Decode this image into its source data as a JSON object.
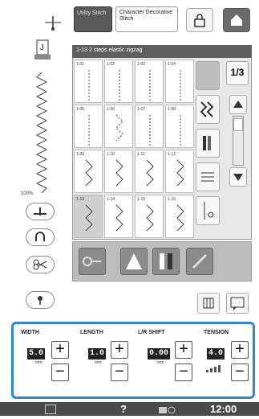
{
  "tabs": {
    "utility_label": "Utility Stitch",
    "character_label": "Character Decorative Stitch"
  },
  "panel": {
    "title": "1-13  2 steps elastic zigzag",
    "page_indicator": {
      "current": "1",
      "total": "3"
    }
  },
  "stitches": [
    {
      "id": "1-01"
    },
    {
      "id": "1-02"
    },
    {
      "id": "1-03"
    },
    {
      "id": "1-04"
    },
    {
      "id": "1-05"
    },
    {
      "id": "1-06"
    },
    {
      "id": "1-07"
    },
    {
      "id": "1-08"
    },
    {
      "id": "1-09"
    },
    {
      "id": "1-10"
    },
    {
      "id": "1-11"
    },
    {
      "id": "1-12"
    },
    {
      "id": "1-13"
    },
    {
      "id": "1-14"
    },
    {
      "id": "1-15"
    },
    {
      "id": "1-16"
    }
  ],
  "selected_stitch": "1-13",
  "left": {
    "zoom_label": "100%"
  },
  "settings": {
    "width": {
      "label": "WIDTH",
      "value": "5.0",
      "unit": "mm"
    },
    "length": {
      "label": "LENGTH",
      "value": "1.0",
      "unit": "mm"
    },
    "lr_shift": {
      "label": "L/R SHIFT",
      "value": "0.00",
      "unit": "mm"
    },
    "tension": {
      "label": "TENSION",
      "value": "4.0"
    }
  },
  "status": {
    "help_label": "?",
    "time": "12:00"
  },
  "colors": {
    "accent": "#2d86d6",
    "dark": "#5f5f5f",
    "status_bg": "#4a4a4a"
  }
}
